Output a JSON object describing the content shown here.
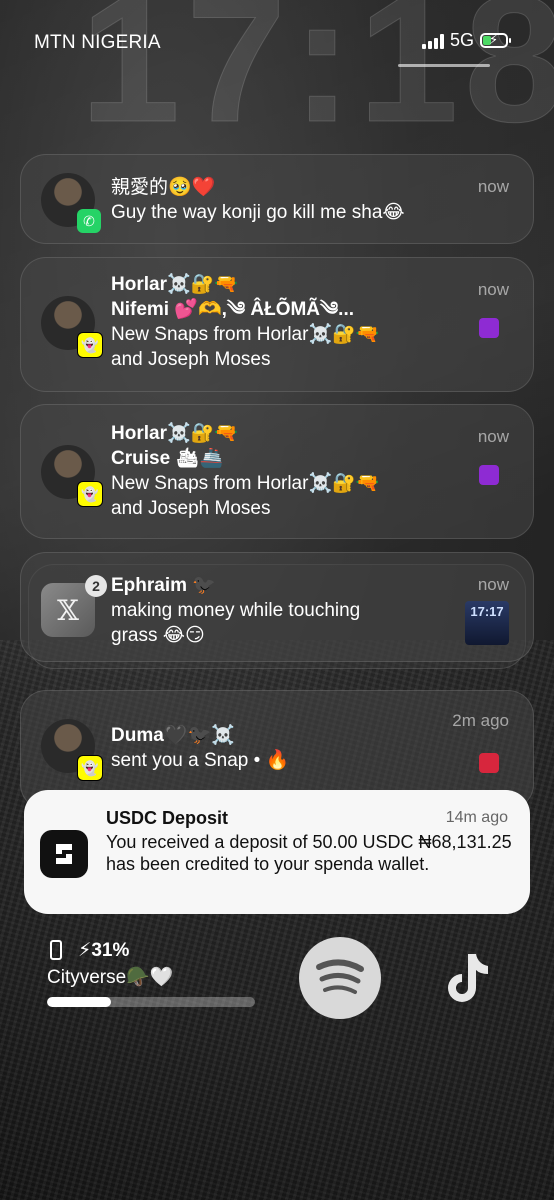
{
  "status_bar": {
    "carrier": "MTN NIGERIA",
    "network": "5G",
    "clock": "17:18"
  },
  "notifications": [
    {
      "app": "WhatsApp",
      "lines": [
        "親愛的🥹❤️",
        "Guy the way konji go kill me sha😂"
      ],
      "time": "now"
    },
    {
      "app": "Snapchat",
      "lines": [
        "Horlar☠️🔐🔫",
        "Nifemi 💕🫶,༄ ÂŁÕMÃ༄...",
        "New Snaps from Horlar☠️🔐🔫",
        "and Joseph Moses"
      ],
      "time": "now",
      "indicator_color": "#8e2bd3"
    },
    {
      "app": "Snapchat",
      "lines": [
        "Horlar☠️🔐🔫",
        "Cruise 🛳🚢",
        "New Snaps from Horlar☠️🔐🔫",
        "and Joseph Moses"
      ],
      "time": "now",
      "indicator_color": "#8e2bd3"
    },
    {
      "app": "X",
      "badge_count": "2",
      "lines": [
        "Ephraim 🐦‍⬛",
        "making money while touching",
        "grass 😂😏"
      ],
      "time": "now",
      "thumbnail_text": "17:17"
    },
    {
      "app": "Snapchat",
      "lines": [
        "Duma🖤🐦‍⬛☠️",
        "sent you a Snap • 🔥"
      ],
      "time": "2m ago",
      "indicator_color": "#d7263d"
    }
  ],
  "usdc": {
    "title": "USDC Deposit",
    "time": "14m ago",
    "body": "You received a deposit of 50.00 USDC ₦68,131.25 has been credited to your spenda wallet."
  },
  "widgets": {
    "battery_pct": "⚡31%",
    "music_title": "Cityverse🪖🤍",
    "music_progress": 0.31
  },
  "colors": {
    "whatsapp": "#25d366",
    "snapchat": "#fffc00",
    "battery_fill": "#4cd964"
  }
}
